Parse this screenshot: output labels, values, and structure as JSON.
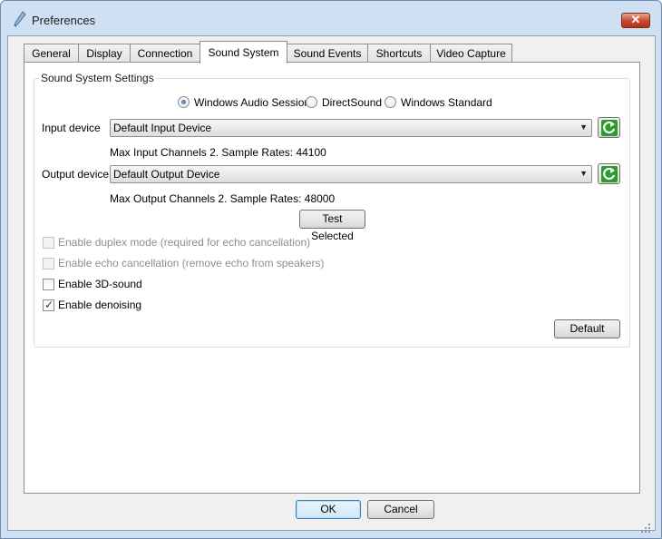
{
  "window": {
    "title": "Preferences",
    "close_symbol": "✕"
  },
  "tabs": [
    {
      "label": "General"
    },
    {
      "label": "Display"
    },
    {
      "label": "Connection"
    },
    {
      "label": "Sound System",
      "active": true
    },
    {
      "label": "Sound Events"
    },
    {
      "label": "Shortcuts"
    },
    {
      "label": "Video Capture"
    }
  ],
  "sound_settings": {
    "group_title": "Sound System Settings",
    "api_options": [
      {
        "label": "Windows Audio Session",
        "selected": true
      },
      {
        "label": "DirectSound",
        "selected": false
      },
      {
        "label": "Windows Standard",
        "selected": false
      }
    ],
    "input": {
      "label": "Input device",
      "value": "Default Input Device",
      "info": "Max Input Channels 2. Sample Rates: 44100"
    },
    "output": {
      "label": "Output device",
      "value": "Default Output Device",
      "info": "Max Output Channels 2. Sample Rates: 48000"
    },
    "test_button": "Test Selected",
    "checkboxes": [
      {
        "label": "Enable duplex mode (required for echo cancellation)",
        "checked": false,
        "enabled": false
      },
      {
        "label": "Enable echo cancellation (remove echo from speakers)",
        "checked": false,
        "enabled": false
      },
      {
        "label": "Enable 3D-sound",
        "checked": false,
        "enabled": true
      },
      {
        "label": "Enable denoising",
        "checked": true,
        "enabled": true
      }
    ],
    "default_button": "Default"
  },
  "footer": {
    "ok": "OK",
    "cancel": "Cancel"
  },
  "colors": {
    "title_bar": "#cfe0f2",
    "refresh_green": "#2e9c2a",
    "close_red": "#c7472d"
  }
}
